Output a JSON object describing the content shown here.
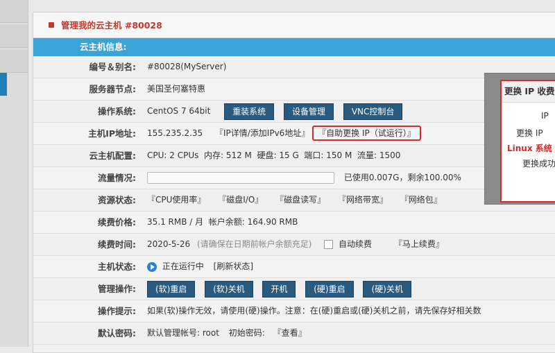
{
  "panel_title": "管理我的云主机 #80028",
  "section_header": "云主机信息:",
  "rows": {
    "id_alias": {
      "label": "编号＆别名:",
      "value": "#80028(MyServer)"
    },
    "node": {
      "label": "服务器节点:",
      "value": "美国圣何塞特惠"
    },
    "os": {
      "label": "操作系统:",
      "value": "CentOS 7 64bit",
      "buttons": [
        "重装系统",
        "设备管理",
        "VNC控制台"
      ]
    },
    "ip": {
      "label": "主机IP地址:",
      "value": "155.235.2.35",
      "link_detail": "『IP详情/添加IPv6地址』",
      "link_change": "『自助更换 IP（试运行）』"
    },
    "config": {
      "label": "云主机配置:",
      "value": "CPU: 2 CPUs  内存: 512 M  硬盘: 15 G  端口: 150 M  流量: 1500"
    },
    "traffic": {
      "label": "流量情况:",
      "used_text": "已使用0.007G，剩余100.00%",
      "remaining_percent": 100
    },
    "resources": {
      "label": "资源状态:",
      "links": [
        "『CPU使用率』",
        "『磁盘I/O』",
        "『磁盘读写』",
        "『网络带宽』",
        "『网络包』"
      ]
    },
    "price": {
      "label": "续费价格:",
      "value": "35.1 RMB / 月  帐户余额: 164.90 RMB"
    },
    "renew": {
      "label": "续费时间:",
      "date": "2020-5-26",
      "note": "(请确保在日期前帐户余额充足)",
      "auto_renew": "自动续费",
      "renew_now": "『马上续费』"
    },
    "status": {
      "label": "主机状态:",
      "running": "正在运行中",
      "refresh": "[刷新状态]"
    },
    "manage": {
      "label": "管理操作:",
      "buttons": [
        "(软)重启",
        "(软)关机",
        "开机",
        "(硬)重启",
        "(硬)关机"
      ]
    },
    "tips": {
      "label": "操作提示:",
      "value": "如果(软)操作无效，请使用(硬)操作。注意：在(硬)重启或(硬)关机之前，请先保存好相关数"
    },
    "password": {
      "label": "默认密码:",
      "account": "默认管理帐号: root",
      "pw_label": "初始密码:",
      "view": "『查看』"
    }
  },
  "popup": {
    "title": "更换 IP 收费",
    "line1": "IP",
    "line2": "更换 IP",
    "line3": "Linux 系统",
    "line4": "更换成功"
  },
  "colors": {
    "accent": "#3aa3d8",
    "button": "#2a5a7e",
    "highlight_red": "#d52b2b"
  }
}
